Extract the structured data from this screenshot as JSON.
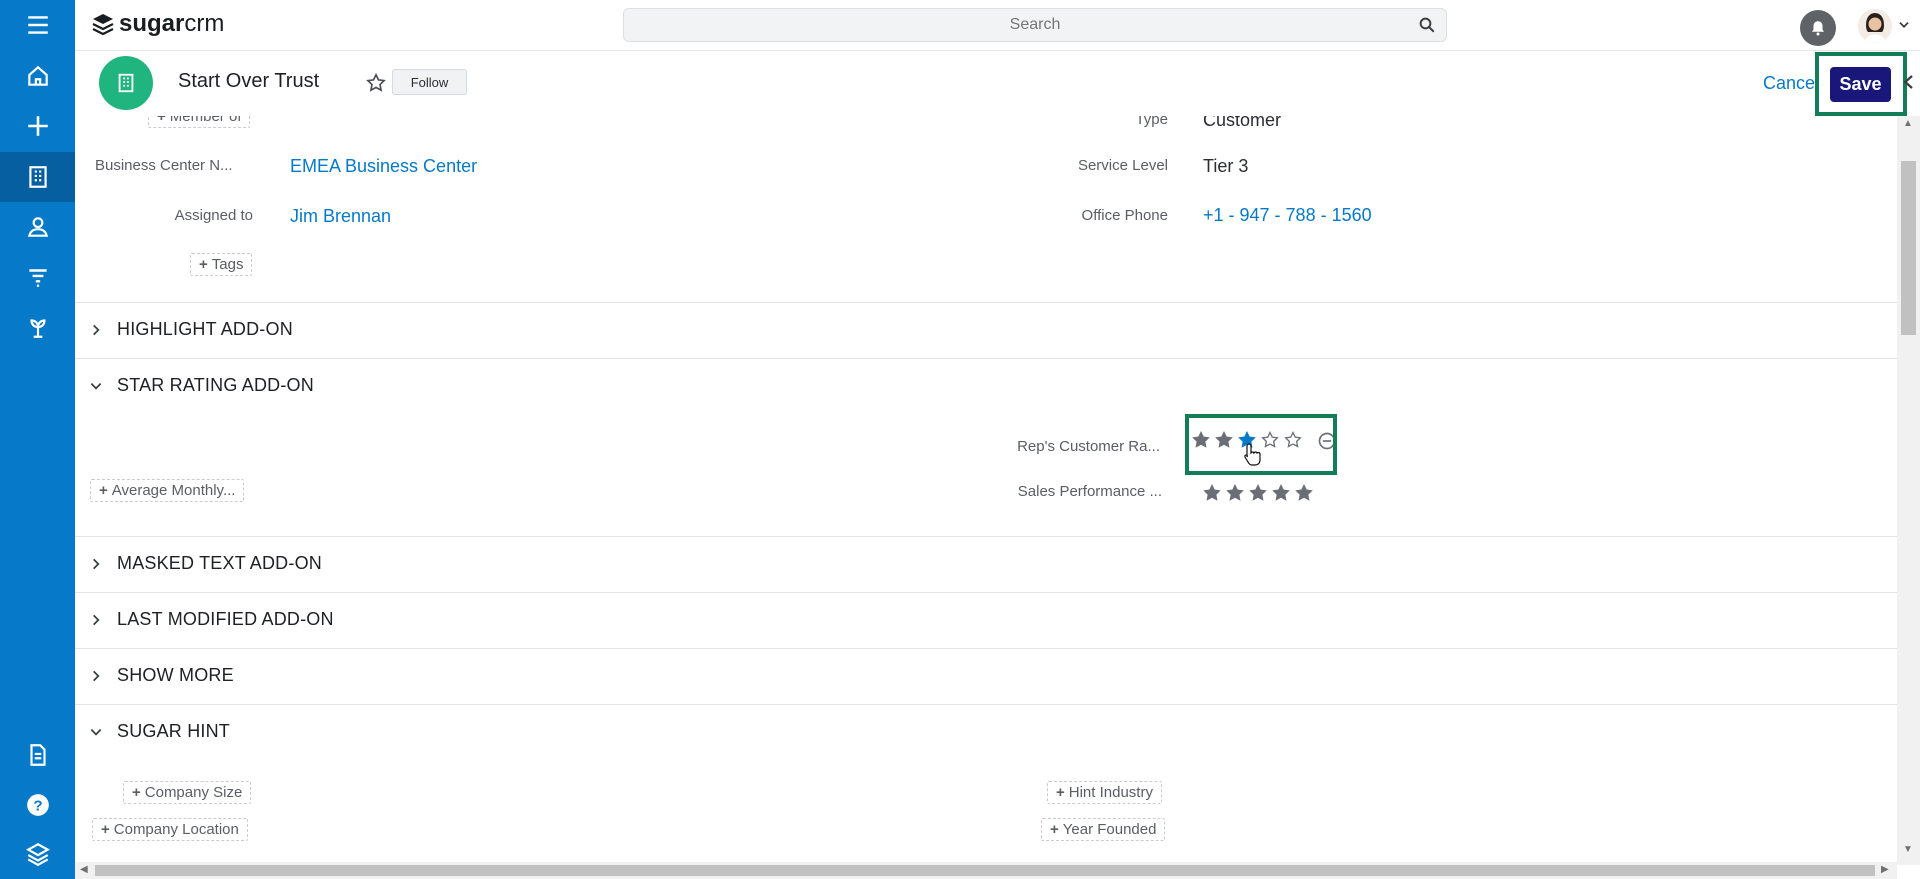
{
  "app": {
    "logo_bold": "sugar",
    "logo_light": "crm"
  },
  "search": {
    "placeholder": "Search"
  },
  "nav": {
    "items": [
      "menu-icon",
      "home-icon",
      "plus-icon",
      "accounts-icon",
      "contacts-icon",
      "filter-icon",
      "plant-icon",
      "document-icon",
      "help-icon",
      "layers-icon"
    ]
  },
  "record": {
    "title": "Start Over Trust",
    "follow_label": "Follow",
    "cancel_label": "Cancel",
    "save_label": "Save"
  },
  "fields": {
    "member_of": "Member of",
    "type_label": "Type",
    "type_value": "Customer",
    "business_center_label": "Business Center N...",
    "business_center_value": "EMEA Business Center",
    "service_level_label": "Service Level",
    "service_level_value": "Tier 3",
    "assigned_to_label": "Assigned to",
    "assigned_to_value": "Jim Brennan",
    "office_phone_label": "Office Phone",
    "office_phone_value": "+1 - 947 - 788 - 1560",
    "tags": "Tags"
  },
  "sections": {
    "highlight": "HIGHLIGHT ADD-ON",
    "star_rating": "STAR RATING ADD-ON",
    "masked_text": "MASKED TEXT ADD-ON",
    "last_modified": "LAST MODIFIED ADD-ON",
    "show_more": "SHOW MORE",
    "sugar_hint": "SUGAR HINT"
  },
  "star_rating": {
    "reps_rating_label": "Rep's Customer Ra...",
    "reps_rating_value": 3,
    "reps_rating_max": 5,
    "average_monthly": "Average Monthly...",
    "sales_performance_label": "Sales Performance ...",
    "sales_performance_value": 5,
    "sales_performance_max": 5
  },
  "sugar_hint": {
    "company_size": "Company Size",
    "hint_industry": "Hint Industry",
    "company_location": "Company Location",
    "year_founded": "Year Founded"
  },
  "colors": {
    "nav_blue": "#0679c8",
    "save_navy": "#19177a",
    "highlight_green": "#137d55",
    "record_icon_green": "#20b57e",
    "star_gray": "#6b6f75",
    "star_blue": "#0679c8"
  }
}
